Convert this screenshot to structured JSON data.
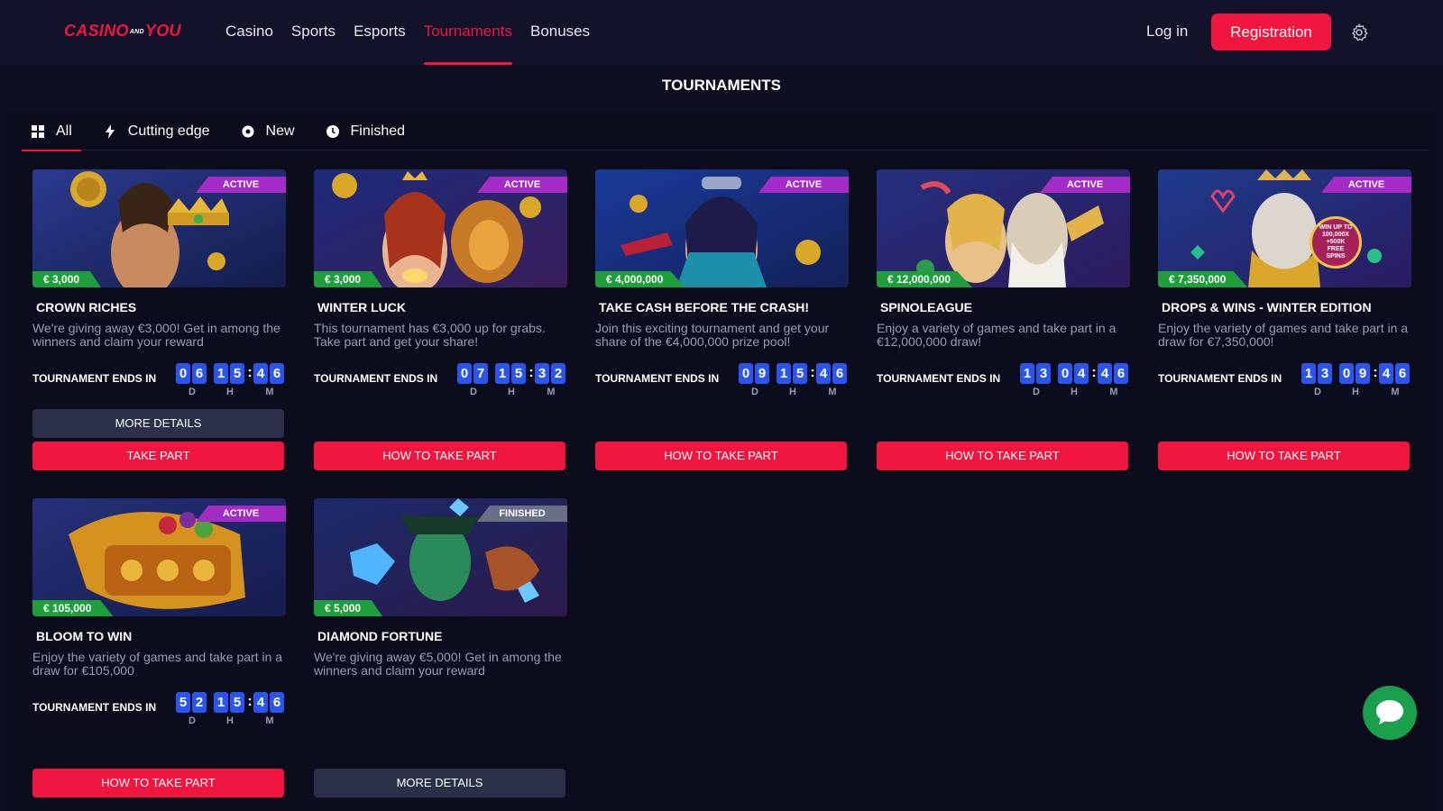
{
  "header": {
    "logo_left": "CASINO",
    "logo_mid": "AND",
    "logo_right": "YOU",
    "nav": [
      "Casino",
      "Sports",
      "Esports",
      "Tournaments",
      "Bonuses"
    ],
    "active_nav": "Tournaments",
    "login": "Log in",
    "register": "Registration",
    "settings_icon": "gear-icon"
  },
  "page_title": "TOURNAMENTS",
  "filters": [
    {
      "label": "All",
      "icon": "grid-icon",
      "active": true
    },
    {
      "label": "Cutting edge",
      "icon": "lightning-icon",
      "active": false
    },
    {
      "label": "New",
      "icon": "gear-badge-icon",
      "active": false
    },
    {
      "label": "Finished",
      "icon": "clock-icon",
      "active": false
    }
  ],
  "timer_label": "TOURNAMENT ENDS IN",
  "units": {
    "d": "D",
    "h": "H",
    "m": "M"
  },
  "cards": [
    {
      "status": "ACTIVE",
      "prize": "€ 3,000",
      "title": "CROWN RICHES",
      "desc": "We're giving away €3,000! Get in among the winners and claim your reward",
      "d": "06",
      "h": "15",
      "m": "46",
      "btn_details": "MORE DETAILS",
      "btn_main": "TAKE PART"
    },
    {
      "status": "ACTIVE",
      "prize": "€ 3,000",
      "title": "WINTER LUCK",
      "desc": "This tournament has €3,000 up for grabs. Take part and get your share!",
      "d": "07",
      "h": "15",
      "m": "32",
      "btn_main": "HOW TO TAKE PART"
    },
    {
      "status": "ACTIVE",
      "prize": "€ 4,000,000",
      "title": "TAKE CASH BEFORE THE CRASH!",
      "desc": "Join this exciting tournament and get your share of the €4,000,000 prize pool!",
      "d": "09",
      "h": "15",
      "m": "46",
      "btn_main": "HOW TO TAKE PART"
    },
    {
      "status": "ACTIVE",
      "prize": "€ 12,000,000",
      "title": "SPINOLEAGUE",
      "desc": "Enjoy a variety of games and take part in a €12,000,000 draw!",
      "d": "13",
      "h": "04",
      "m": "46",
      "btn_main": "HOW TO TAKE PART"
    },
    {
      "status": "ACTIVE",
      "prize": "€ 7,350,000",
      "title": "DROPS & WINS - WINTER EDITION",
      "desc": "Enjoy the variety of games and take part in a draw for €7,350,000!",
      "d": "13",
      "h": "09",
      "m": "46",
      "btn_main": "HOW TO TAKE PART",
      "img_badge": "WIN UP TO 100,000X +500K FREE SPINS"
    },
    {
      "status": "ACTIVE",
      "prize": "€ 105,000",
      "title": "BLOOM TO WIN",
      "desc": "Enjoy the variety of games and take part in a draw for €105,000",
      "d": "52",
      "h": "15",
      "m": "46",
      "btn_main": "HOW TO TAKE PART"
    },
    {
      "status": "FINISHED",
      "prize": "€ 5,000",
      "title": "DIAMOND FORTUNE",
      "desc": "We're giving away €5,000! Get in among the winners and claim your reward",
      "btn_details": "MORE DETAILS"
    }
  ],
  "chat_icon": "chat-bubble-icon",
  "colors": {
    "accent": "#f0163f",
    "active_badge": "#a52bc7",
    "finished_badge": "#6a6f88",
    "prize_badge": "#1e9f3c",
    "timer_digit": "#2a56ef",
    "chat": "#1aa04d"
  }
}
